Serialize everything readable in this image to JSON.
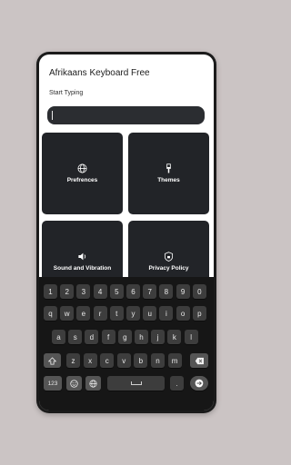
{
  "app": {
    "title": "Afrikaans Keyboard Free",
    "start_label": "Start Typing",
    "input_value": ""
  },
  "tiles": [
    {
      "label": "Prefrences",
      "icon": "globe-icon"
    },
    {
      "label": "Themes",
      "icon": "paintbrush-icon"
    },
    {
      "label": "Sound and Vibration",
      "icon": "speaker-icon"
    },
    {
      "label": "Privacy Policy",
      "icon": "shield-icon"
    }
  ],
  "keyboard": {
    "row_numbers": [
      "1",
      "2",
      "3",
      "4",
      "5",
      "6",
      "7",
      "8",
      "9",
      "0"
    ],
    "row_top": [
      "q",
      "w",
      "e",
      "r",
      "t",
      "y",
      "u",
      "i",
      "o",
      "p"
    ],
    "row_home": [
      "a",
      "s",
      "d",
      "f",
      "g",
      "h",
      "j",
      "k",
      "l"
    ],
    "row_bottom": [
      "z",
      "x",
      "c",
      "v",
      "b",
      "n",
      "m"
    ],
    "numbers_mode_label": "123",
    "icons": {
      "shift": "shift-arrow-icon",
      "backspace": "backspace-icon",
      "emoji": "emoji-icon",
      "language": "globe-icon",
      "enter": "arrow-right-icon"
    }
  },
  "colors": {
    "background": "#cbc4c4",
    "tile": "#222428",
    "key": "#3d3d3d",
    "keyboard": "#161616"
  }
}
